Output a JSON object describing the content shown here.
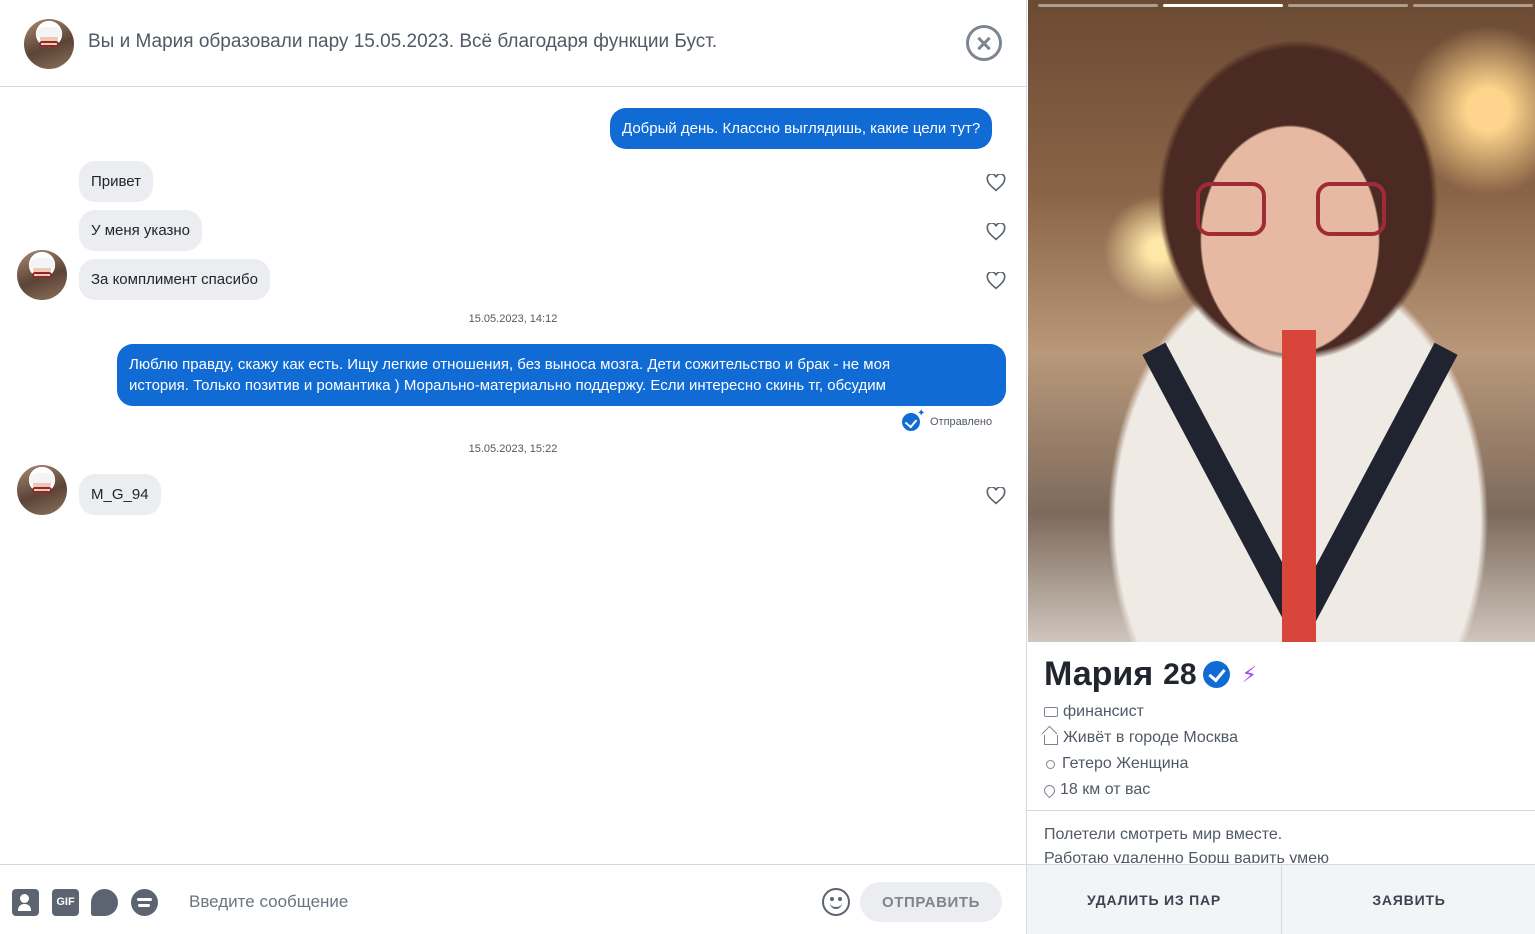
{
  "header": {
    "title": "Вы и Мария образовали пару 15.05.2023. Всё благодаря функции Буст."
  },
  "messages": {
    "out_1": "Добрый день. Классно выглядишь, какие цели тут?",
    "in_1": "Привет",
    "in_2": "У меня указно",
    "in_3": "За комплимент спасибо",
    "timestamp_1": "15.05.2023, 14:12",
    "out_2_line1": "Люблю правду, скажу как есть. Ищу легкие отношения, без выноса мозга. Дети сожительство и брак - не моя",
    "out_2_line2": "история. Только позитив и романтика ) Морально-материально поддержу. Если интересно скинь тг, обсудим",
    "status": "Отправлено",
    "timestamp_2": "15.05.2023, 15:22",
    "in_4": "M_G_94"
  },
  "composer": {
    "placeholder": "Введите сообщение",
    "gif_label": "GIF",
    "send_label": "ОТПРАВИТЬ"
  },
  "profile": {
    "name": "Мария",
    "age": "28",
    "job": "финансист",
    "city": "Живёт в городе Москва",
    "orientation": "Гетеро Женщина",
    "distance": "18 км от вас",
    "bio_line1": "Полетели смотреть мир вместе.",
    "bio_line2": "Работаю удаленно Борщ варить умею",
    "photo_count": 4,
    "active_photo": 2,
    "boost_icon": "⚡",
    "accent_color": "#106bd5",
    "boost_color": "#a24bf2"
  },
  "actions": {
    "unmatch_label": "УДАЛИТЬ ИЗ ПАР",
    "report_label": "ЗАЯВИТЬ"
  }
}
